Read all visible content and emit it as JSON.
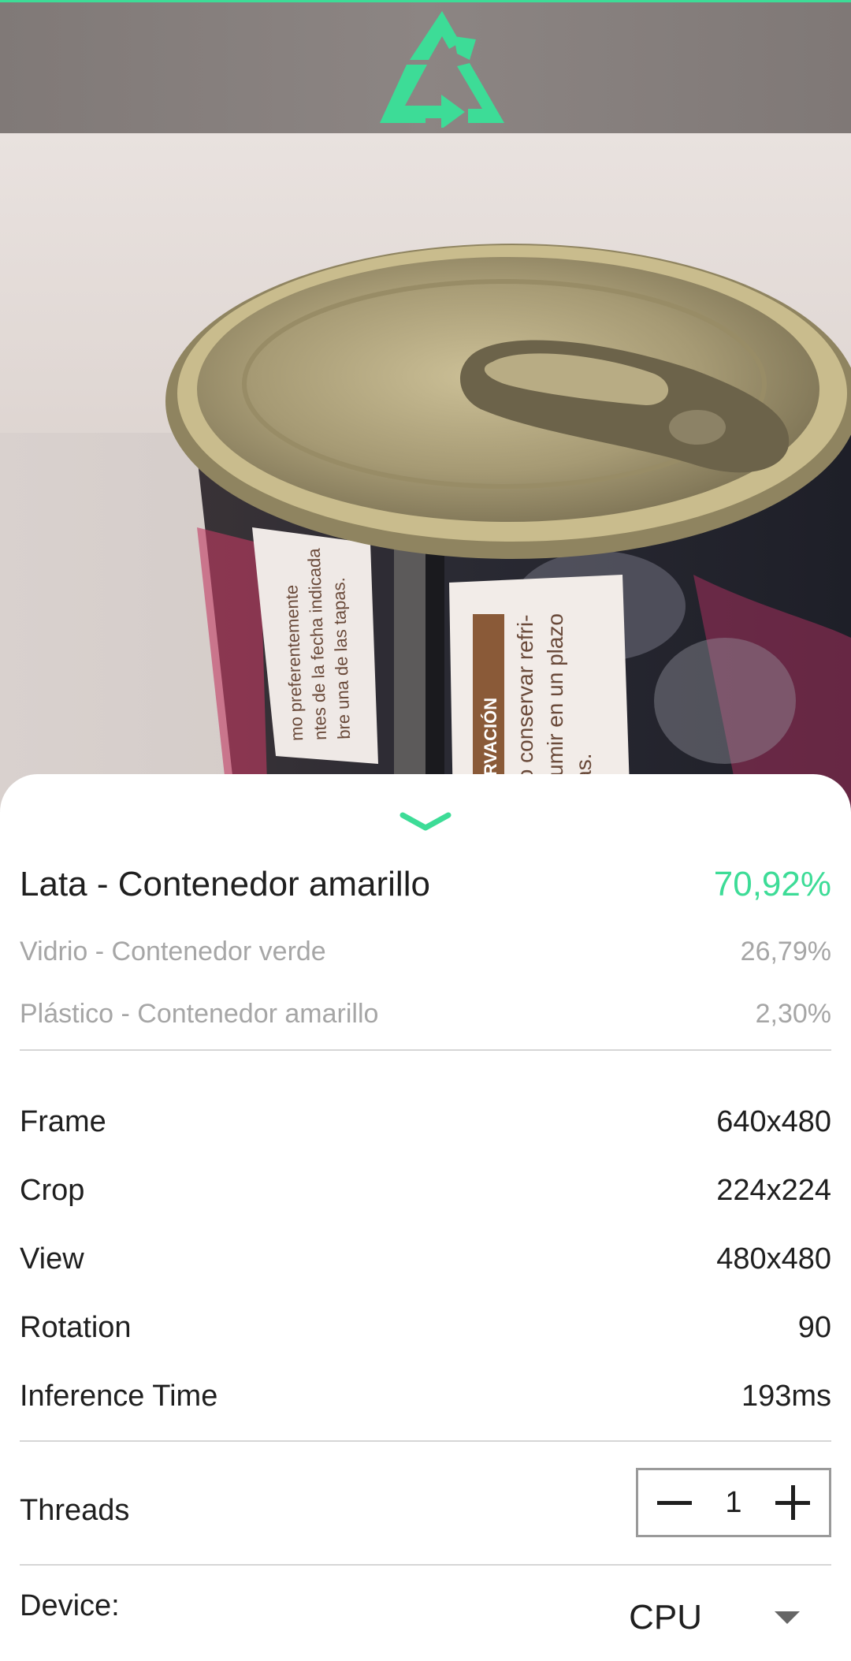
{
  "app": {
    "logo_icon": "recycle-icon",
    "accent_color": "#3ddc97"
  },
  "camera": {
    "label_text_1": "ERVACIÓN",
    "label_text_2": "to conservar refri-",
    "label_text_3": "sumir en un plazo",
    "label_text_4": "ias.",
    "label_text_5": "mo preferentemente",
    "label_text_6": "ntes de la fecha indicada",
    "label_text_7": "bre una de las tapas."
  },
  "results": {
    "top": {
      "label": "Lata - Contenedor amarillo",
      "value": "70,92%"
    },
    "second": {
      "label": "Vidrio - Contenedor verde",
      "value": "26,79%"
    },
    "third": {
      "label": "Plástico - Contenedor amarillo",
      "value": "2,30%"
    }
  },
  "info": {
    "frame": {
      "label": "Frame",
      "value": "640x480"
    },
    "crop": {
      "label": "Crop",
      "value": "224x224"
    },
    "view": {
      "label": "View",
      "value": "480x480"
    },
    "rotation": {
      "label": "Rotation",
      "value": "90"
    },
    "inference": {
      "label": "Inference Time",
      "value": "193ms"
    }
  },
  "threads": {
    "label": "Threads",
    "count": "1"
  },
  "device": {
    "label": "Device:",
    "selected": "CPU"
  }
}
